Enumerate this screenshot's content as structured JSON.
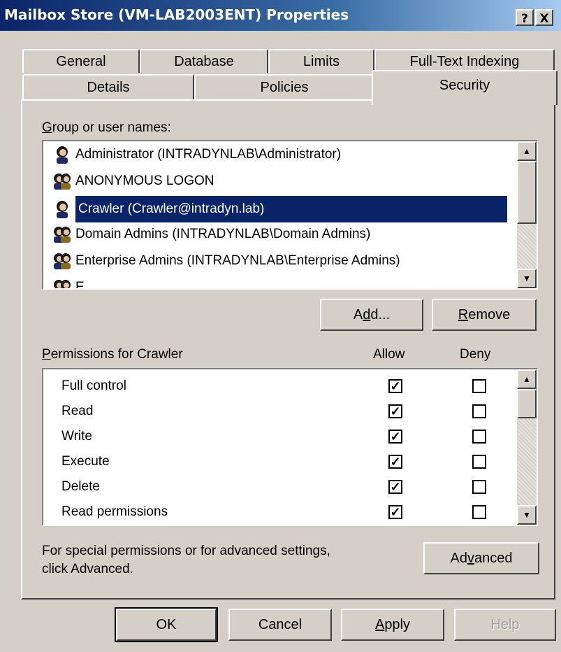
{
  "window": {
    "title": "Mailbox Store (VM-LAB2003ENT) Properties",
    "help_btn": "?",
    "close_btn": "X"
  },
  "tabs_row1": [
    "General",
    "Database",
    "Limits",
    "Full-Text Indexing"
  ],
  "tabs_row2": [
    "Details",
    "Policies",
    "Security"
  ],
  "active_tab": "Security",
  "groups": {
    "label": "Group or user names:",
    "items": [
      {
        "name": "Administrator (INTRADYNLAB\\Administrator)",
        "icon": "user-icon"
      },
      {
        "name": "ANONYMOUS LOGON",
        "icon": "group-icon"
      },
      {
        "name": "Crawler (Crawler@intradyn.lab)",
        "icon": "user-icon",
        "selected": true
      },
      {
        "name": "Domain Admins (INTRADYNLAB\\Domain Admins)",
        "icon": "group-icon"
      },
      {
        "name": "Enterprise Admins (INTRADYNLAB\\Enterprise Admins)",
        "icon": "group-icon"
      },
      {
        "name": "E",
        "icon": "group-icon"
      }
    ],
    "add_btn": "Add...",
    "remove_btn": "Remove"
  },
  "permissions": {
    "label": "Permissions for Crawler",
    "allow_header": "Allow",
    "deny_header": "Deny",
    "rows": [
      {
        "name": "Full control",
        "allow": true,
        "deny": false
      },
      {
        "name": "Read",
        "allow": true,
        "deny": false
      },
      {
        "name": "Write",
        "allow": true,
        "deny": false
      },
      {
        "name": "Execute",
        "allow": true,
        "deny": false
      },
      {
        "name": "Delete",
        "allow": true,
        "deny": false
      },
      {
        "name": "Read permissions",
        "allow": true,
        "deny": false
      }
    ]
  },
  "advanced": {
    "text_line1": "For special permissions or for advanced settings,",
    "text_line2": "click Advanced.",
    "btn": "Advanced"
  },
  "footer": {
    "ok": "OK",
    "cancel": "Cancel",
    "apply": "Apply",
    "help": "Help"
  }
}
